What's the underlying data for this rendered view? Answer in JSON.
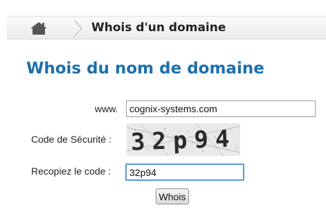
{
  "breadcrumb": {
    "home_icon": "home-icon",
    "separator_icon": "chevron-right-icon",
    "current": "Whois d'un domaine"
  },
  "page": {
    "title": "Whois du nom de domaine"
  },
  "form": {
    "domain_label": "www.",
    "domain_value": "cognix-systems.com",
    "security_label": "Code de Sécurité :",
    "captcha_text": "32p94",
    "copy_label": "Recopiez le code :",
    "copy_value": "32p94",
    "submit_label": "Whois"
  },
  "colors": {
    "title": "#1c6fae",
    "focus_border": "#5b98d6"
  }
}
